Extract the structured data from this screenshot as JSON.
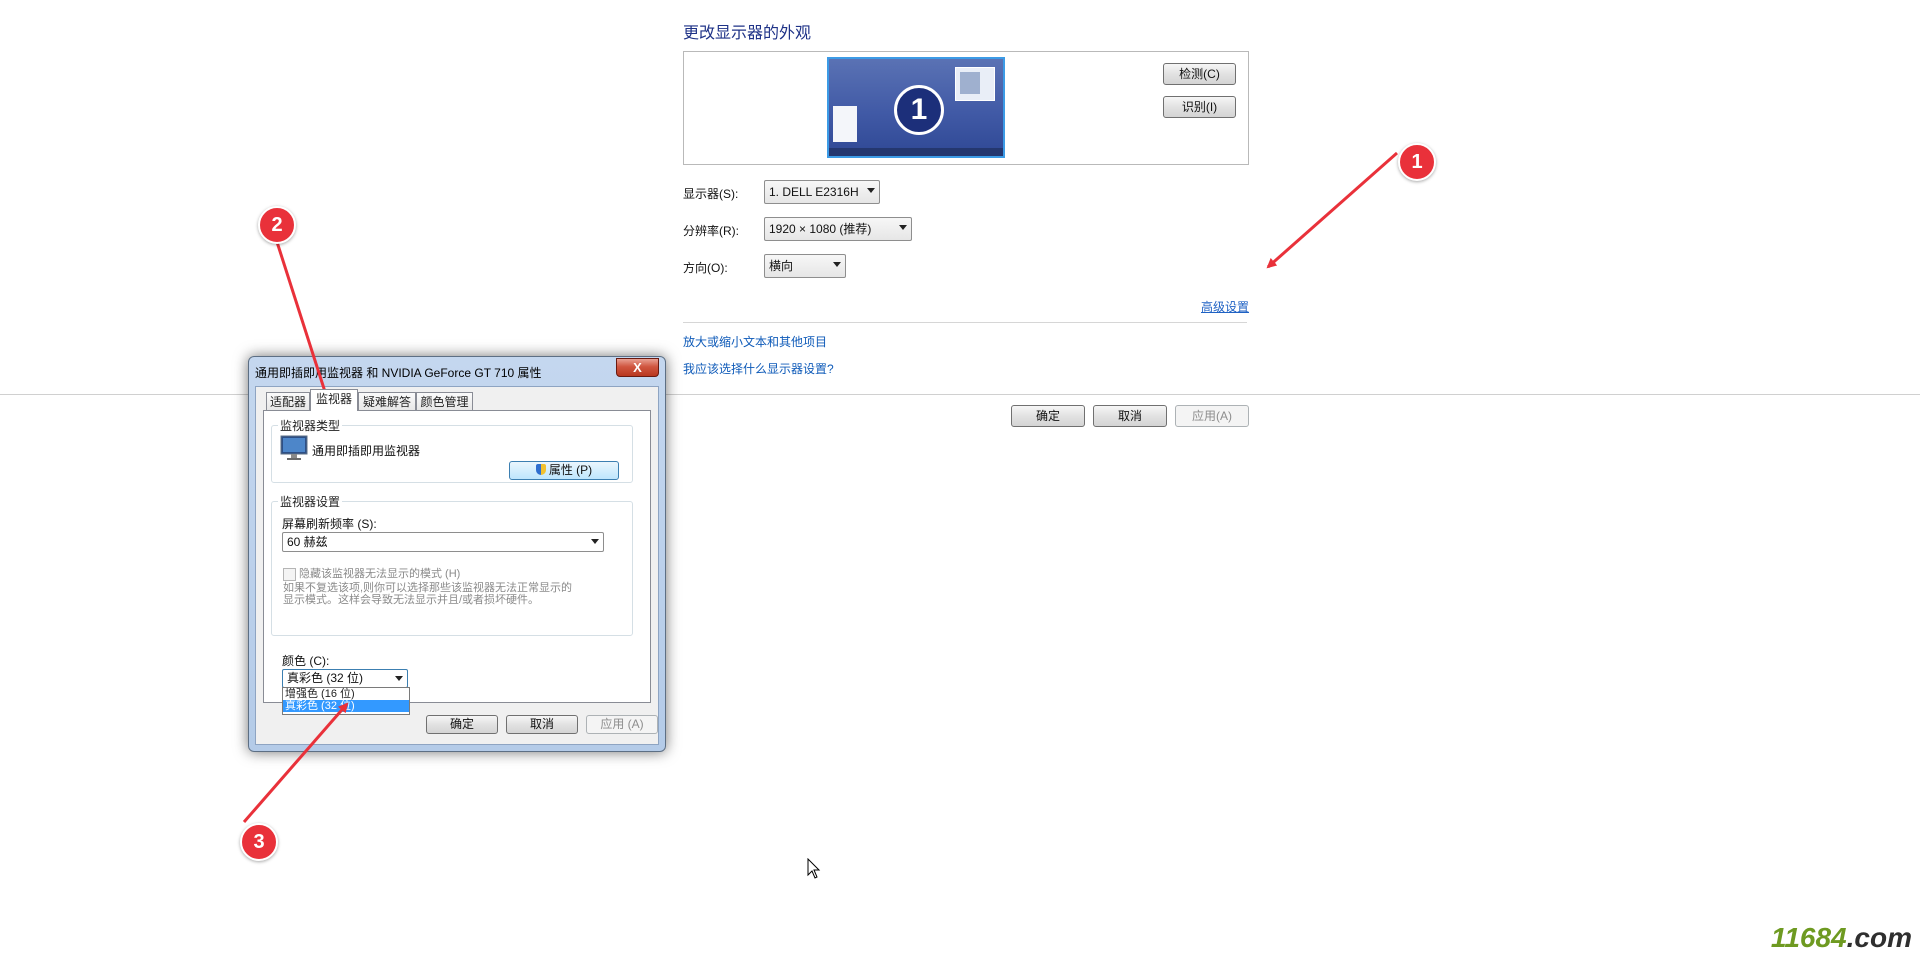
{
  "display": {
    "title": "更改显示器的外观",
    "monitor_number": "1",
    "detect_button": "检测(C)",
    "identify_button": "识别(I)",
    "monitor_label": "显示器(S):",
    "monitor_value": "1. DELL E2316H",
    "resolution_label": "分辨率(R):",
    "resolution_value": "1920 × 1080 (推荐)",
    "orientation_label": "方向(O):",
    "orientation_value": "横向",
    "advanced_link": "高级设置",
    "links": [
      "放大或缩小文本和其他项目",
      "我应该选择什么显示器设置?"
    ],
    "ok": "确定",
    "cancel": "取消",
    "apply": "应用(A)"
  },
  "dialog": {
    "title": "通用即插即用监视器 和 NVIDIA GeForce GT 710 属性",
    "close": "X",
    "tabs": [
      "适配器",
      "监视器",
      "疑难解答",
      "颜色管理"
    ],
    "active_tab": "监视器",
    "monitor_type_group": "监视器类型",
    "monitor_type_value": "通用即插即用监视器",
    "properties_button": "属性 (P)",
    "monitor_settings_group": "监视器设置",
    "refresh_label": "屏幕刷新频率 (S):",
    "refresh_value": "60 赫兹",
    "hide_modes_label": "隐藏该监视器无法显示的模式 (H)",
    "hide_modes_desc_line1": "如果不复选该项,则你可以选择那些该监视器无法正常显示的",
    "hide_modes_desc_line2": "显示模式。这样会导致无法显示并且/或者损坏硬件。",
    "color_label": "颜色 (C):",
    "color_value": "真彩色 (32 位)",
    "color_options": [
      "增强色 (16 位)",
      "真彩色 (32 位)"
    ],
    "ok": "确定",
    "cancel": "取消",
    "apply": "应用 (A)"
  },
  "callouts": [
    "1",
    "2",
    "3"
  ],
  "annotation_color": "#e9313a",
  "watermark": {
    "part1": "11684",
    "part2": ".com"
  }
}
